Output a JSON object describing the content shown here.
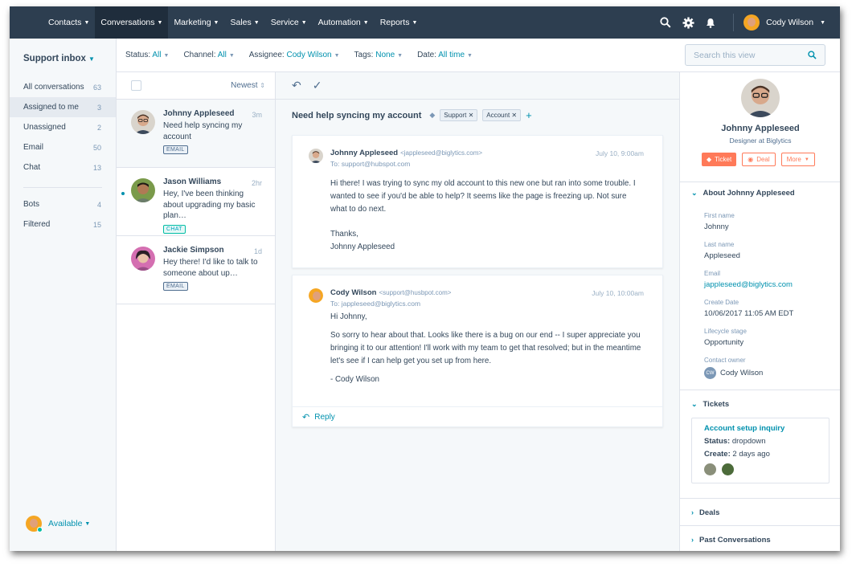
{
  "nav": {
    "items": [
      {
        "label": "Contacts",
        "active": false
      },
      {
        "label": "Conversations",
        "active": true
      },
      {
        "label": "Marketing",
        "active": false
      },
      {
        "label": "Sales",
        "active": false
      },
      {
        "label": "Service",
        "active": false
      },
      {
        "label": "Automation",
        "active": false
      },
      {
        "label": "Reports",
        "active": false
      }
    ],
    "user_name": "Cody Wilson"
  },
  "sidebar": {
    "title": "Support inbox",
    "items": [
      {
        "label": "All conversations",
        "count": "63"
      },
      {
        "label": "Assigned to me",
        "count": "3"
      },
      {
        "label": "Unassigned",
        "count": "2"
      },
      {
        "label": "Email",
        "count": "50"
      },
      {
        "label": "Chat",
        "count": "13"
      }
    ],
    "items2": [
      {
        "label": "Bots",
        "count": "4"
      },
      {
        "label": "Filtered",
        "count": "15"
      }
    ],
    "status": "Available"
  },
  "filters": {
    "status_label": "Status:",
    "status_value": "All",
    "channel_label": "Channel:",
    "channel_value": "All",
    "assignee_label": "Assignee:",
    "assignee_value": "Cody Wilson",
    "tags_label": "Tags:",
    "tags_value": "None",
    "date_label": "Date:",
    "date_value": "All time",
    "search_placeholder": "Search this view"
  },
  "list": {
    "sort": "Newest",
    "conversations": [
      {
        "name": "Johnny Appleseed",
        "time": "3m",
        "preview": "Need help syncing my account",
        "tag": "EMAIL"
      },
      {
        "name": "Jason Williams",
        "time": "2hr",
        "preview": "Hey, I've been thinking about upgrading my basic plan…",
        "tag": "CHAT"
      },
      {
        "name": "Jackie Simpson",
        "time": "1d",
        "preview": "Hey there! I'd like to talk to someone about up…",
        "tag": "EMAIL"
      }
    ]
  },
  "thread": {
    "subject": "Need help syncing my account",
    "tags": [
      "Support",
      "Account"
    ],
    "messages": [
      {
        "from": "Johnny Appleseed",
        "email": "<jappleseed@biglytics.com>",
        "to": "To: support@hubspot.com",
        "date": "July 10, 9:00am",
        "p1": "Hi there! I was trying to sync my old account to this new one but ran into some trouble. I wanted to see if you'd be able to help? It seems like the page is freezing up. Not sure what to do next.",
        "p2a": "Thanks,",
        "p2b": "Johnny Appleseed"
      },
      {
        "from": "Cody Wilson",
        "email": "<support@husbpot.com>",
        "to": "To: jappleseed@biglytics.com",
        "date": "July 10, 10:00am",
        "p1": "Hi Johnny,",
        "p2": "So sorry to hear about that. Looks like there is a bug on our end -- I super appreciate you bringing it to our attention! I'll work with my team to get that resolved; but in the meantime let's see if I can help get you set up from here.",
        "p3": "- Cody Wilson",
        "reply": "Reply"
      }
    ]
  },
  "contact": {
    "name": "Johnny Appleseed",
    "role": "Designer at Biglytics",
    "buttons": {
      "ticket": "Ticket",
      "deal": "Deal",
      "more": "More"
    },
    "about_title": "About Johnny Appleseed",
    "props": [
      {
        "label": "First name",
        "value": "Johnny"
      },
      {
        "label": "Last name",
        "value": "Appleseed"
      },
      {
        "label": "Email",
        "value": "jappleseed@biglytics.com"
      },
      {
        "label": "Create Date",
        "value": "10/06/2017 11:05 AM EDT"
      },
      {
        "label": "Lifecycle stage",
        "value": "Opportunity"
      },
      {
        "label": "Contact owner",
        "value": "Cody Wilson",
        "initials": "CW"
      }
    ],
    "tickets_title": "Tickets",
    "ticket": {
      "title": "Account setup inquiry",
      "status_label": "Status:",
      "status_value": "dropdown",
      "create_label": "Create:",
      "create_value": "2 days ago"
    },
    "deals_title": "Deals",
    "past_title": "Past Conversations"
  },
  "colors": {
    "nav_bg": "#2d3e50",
    "accent": "#0091ae",
    "orange": "#ff7a59",
    "teal": "#00bda5"
  }
}
